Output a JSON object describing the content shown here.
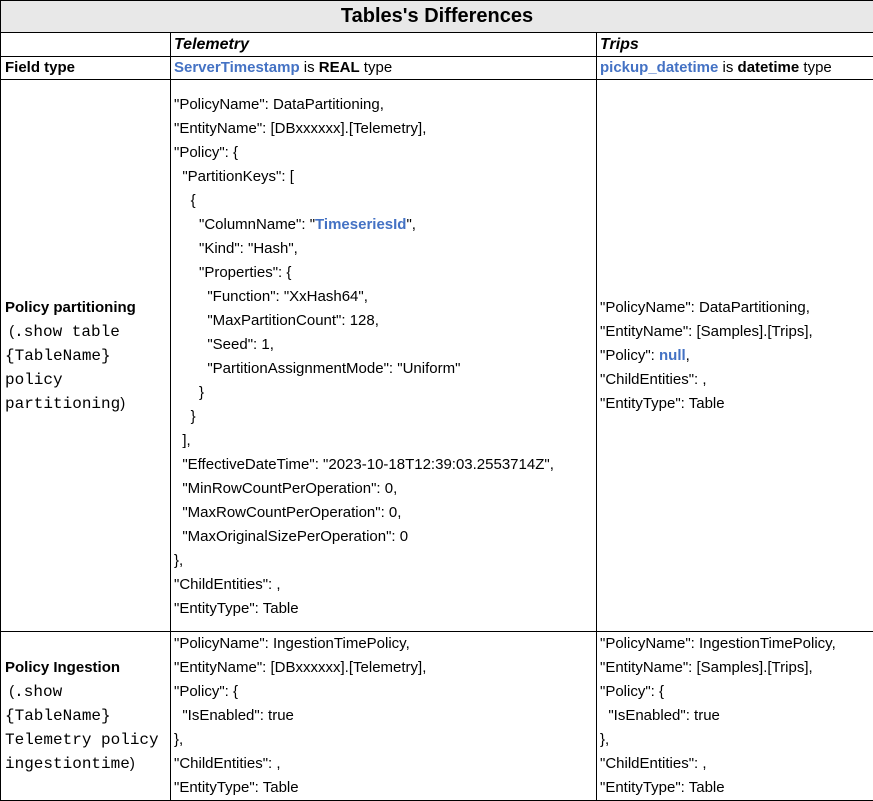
{
  "title": "Tables's Differences",
  "columns": [
    "Telemetry",
    "Trips"
  ],
  "field_type": {
    "label": "Field type",
    "telemetry": {
      "field": "ServerTimestamp",
      "mid": " is ",
      "type": "REAL",
      "tail": " type"
    },
    "trips": {
      "field": "pickup_datetime",
      "mid": " is ",
      "type": "datetime",
      "tail": " type"
    }
  },
  "partitioning": {
    "label_bold": "Policy partitioning",
    "label_paren_open": " (",
    "label_mono": ".show table {TableName} policy partitioning",
    "label_paren_close": ")",
    "telemetry_lines": [
      "\"PolicyName\": DataPartitioning,",
      "\"EntityName\": [DBxxxxxx].[Telemetry],",
      "\"Policy\": {",
      "  \"PartitionKeys\": [",
      "    {",
      "      \"ColumnName\": \"",
      "      \"Kind\": \"Hash\",",
      "      \"Properties\": {",
      "        \"Function\": \"XxHash64\",",
      "        \"MaxPartitionCount\": 128,",
      "        \"Seed\": 1,",
      "        \"PartitionAssignmentMode\": \"Uniform\"",
      "      }",
      "    }",
      "  ],",
      "  \"EffectiveDateTime\": \"2023-10-18T12:39:03.2553714Z\",",
      "  \"MinRowCountPerOperation\": 0,",
      "  \"MaxRowCountPerOperation\": 0,",
      "  \"MaxOriginalSizePerOperation\": 0",
      "},",
      "\"ChildEntities\": ,",
      "\"EntityType\": Table"
    ],
    "telemetry_highlight": "TimeseriesId",
    "telemetry_highlight_tail": "\",",
    "trips_lines": [
      "\"PolicyName\": DataPartitioning,",
      "\"EntityName\": [Samples].[Trips],",
      "\"Policy\": ",
      "\"ChildEntities\": ,",
      "\"EntityType\": Table"
    ],
    "trips_highlight": "null",
    "trips_highlight_tail": ","
  },
  "ingestion": {
    "label_bold": "Policy Ingestion",
    "label_paren_open": " (",
    "label_mono": ".show {TableName} Telemetry policy ingestiontime",
    "label_paren_close": ")",
    "telemetry_lines": [
      "\"PolicyName\": IngestionTimePolicy,",
      "\"EntityName\": [DBxxxxxx].[Telemetry],",
      "\"Policy\": {",
      "  \"IsEnabled\": true",
      "},",
      "\"ChildEntities\": ,",
      "\"EntityType\": Table"
    ],
    "trips_lines": [
      "\"PolicyName\": IngestionTimePolicy,",
      "\"EntityName\": [Samples].[Trips],",
      "\"Policy\": {",
      "  \"IsEnabled\": true",
      "},",
      "\"ChildEntities\": ,",
      "\"EntityType\": Table"
    ]
  }
}
